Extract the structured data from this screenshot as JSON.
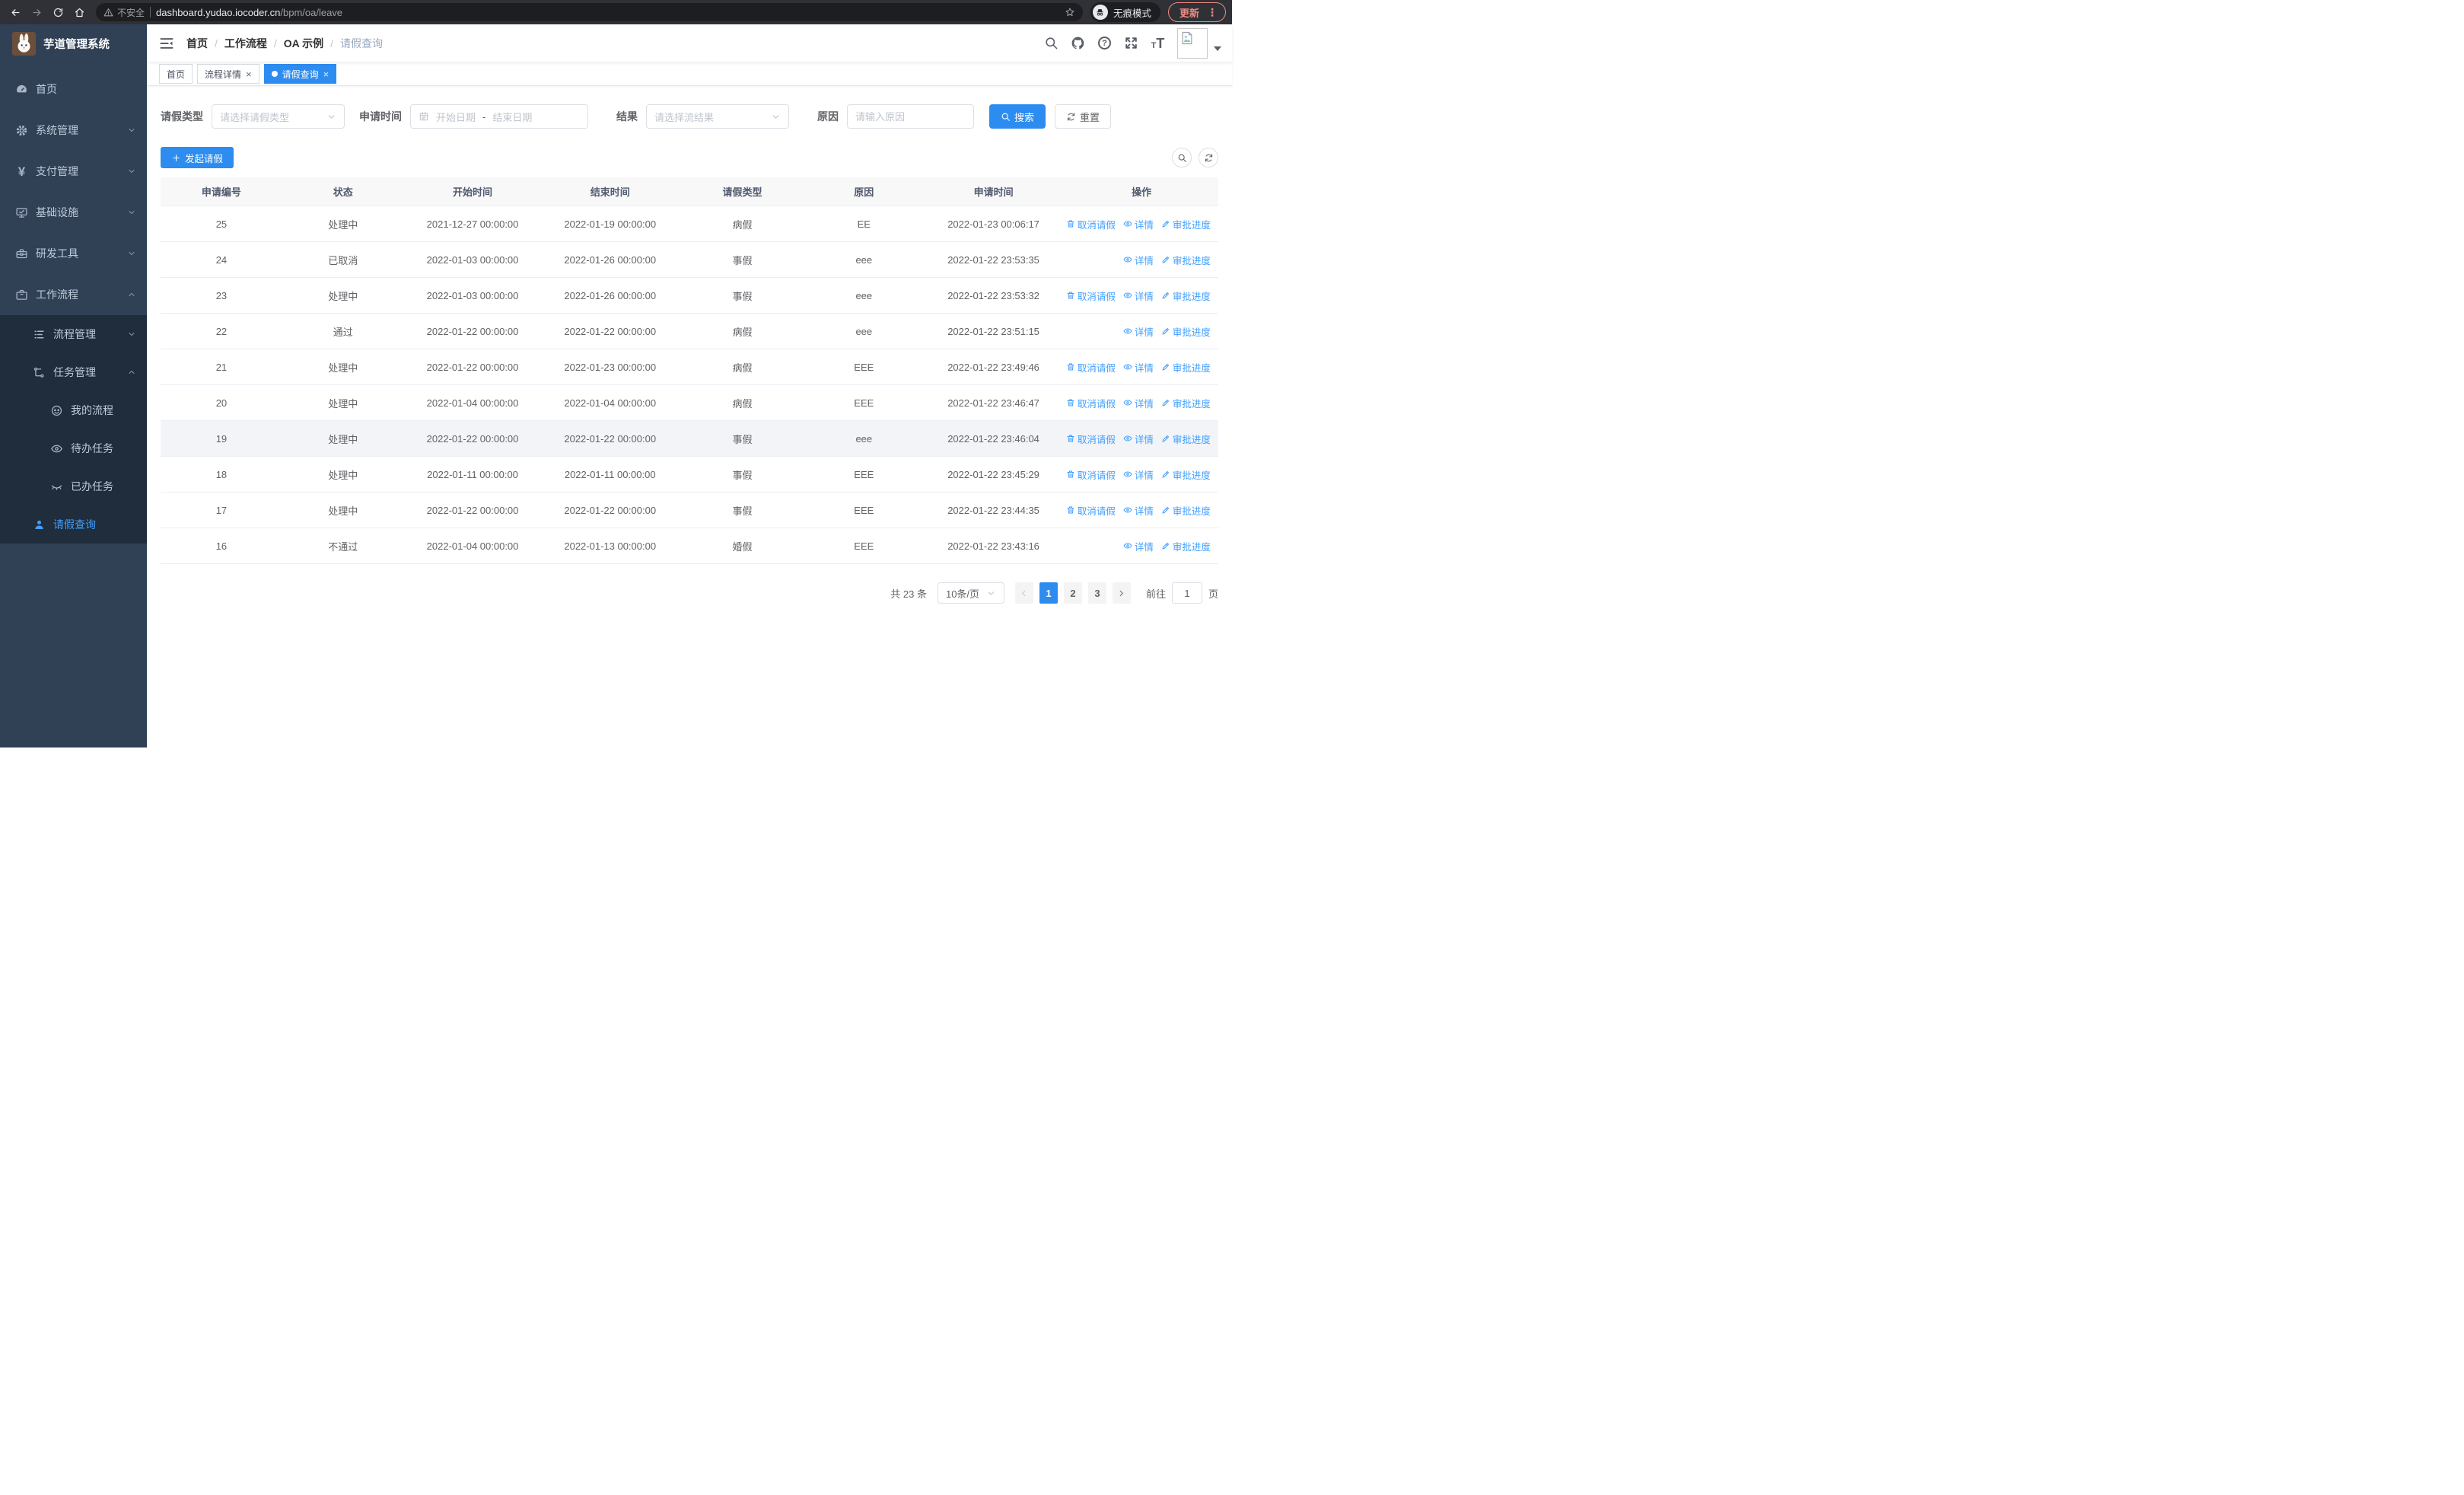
{
  "browser": {
    "security_warning": "不安全",
    "url_host": "dashboard.yudao.iocoder.cn",
    "url_path": "/bpm/oa/leave",
    "incognito_label": "无痕模式",
    "update_label": "更新"
  },
  "sidebar": {
    "app_title": "芋道管理系统",
    "items": [
      {
        "label": "首页",
        "icon": "dashboard-icon"
      },
      {
        "label": "系统管理",
        "icon": "gear-icon"
      },
      {
        "label": "支付管理",
        "icon": "yen-icon"
      },
      {
        "label": "基础设施",
        "icon": "monitor-icon"
      },
      {
        "label": "研发工具",
        "icon": "toolbox-icon"
      },
      {
        "label": "工作流程",
        "icon": "briefcase-icon"
      },
      {
        "label": "流程管理",
        "icon": "list-icon"
      },
      {
        "label": "任务管理",
        "icon": "tree-icon"
      },
      {
        "label": "我的流程",
        "icon": "face-icon"
      },
      {
        "label": "待办任务",
        "icon": "eye-icon"
      },
      {
        "label": "已办任务",
        "icon": "eye-closed-icon"
      },
      {
        "label": "请假查询",
        "icon": "user-icon"
      }
    ]
  },
  "header": {
    "breadcrumb": [
      "首页",
      "工作流程",
      "OA 示例",
      "请假查询"
    ],
    "separator": "/"
  },
  "tabs": [
    {
      "label": "首页",
      "closable": false,
      "active": false
    },
    {
      "label": "流程详情",
      "closable": true,
      "active": false
    },
    {
      "label": "请假查询",
      "closable": true,
      "active": true
    }
  ],
  "filters": {
    "type_label": "请假类型",
    "type_placeholder": "请选择请假类型",
    "time_label": "申请时间",
    "start_placeholder": "开始日期",
    "range_separator": "-",
    "end_placeholder": "结束日期",
    "result_label": "结果",
    "result_placeholder": "请选择流结果",
    "reason_label": "原因",
    "reason_placeholder": "请输入原因",
    "search_label": "搜索",
    "reset_label": "重置"
  },
  "toolbar": {
    "create_label": "发起请假"
  },
  "table": {
    "columns": [
      "申请编号",
      "状态",
      "开始时间",
      "结束时间",
      "请假类型",
      "原因",
      "申请时间",
      "操作"
    ],
    "actions": {
      "cancel": "取消请假",
      "detail": "详情",
      "progress": "审批进度"
    },
    "rows": [
      {
        "id": "25",
        "status": "处理中",
        "start": "2021-12-27 00:00:00",
        "end": "2022-01-19 00:00:00",
        "type": "病假",
        "reason": "EE",
        "applied": "2022-01-23 00:06:17"
      },
      {
        "id": "24",
        "status": "已取消",
        "start": "2022-01-03 00:00:00",
        "end": "2022-01-26 00:00:00",
        "type": "事假",
        "reason": "eee",
        "applied": "2022-01-22 23:53:35"
      },
      {
        "id": "23",
        "status": "处理中",
        "start": "2022-01-03 00:00:00",
        "end": "2022-01-26 00:00:00",
        "type": "事假",
        "reason": "eee",
        "applied": "2022-01-22 23:53:32"
      },
      {
        "id": "22",
        "status": "通过",
        "start": "2022-01-22 00:00:00",
        "end": "2022-01-22 00:00:00",
        "type": "病假",
        "reason": "eee",
        "applied": "2022-01-22 23:51:15"
      },
      {
        "id": "21",
        "status": "处理中",
        "start": "2022-01-22 00:00:00",
        "end": "2022-01-23 00:00:00",
        "type": "病假",
        "reason": "EEE",
        "applied": "2022-01-22 23:49:46"
      },
      {
        "id": "20",
        "status": "处理中",
        "start": "2022-01-04 00:00:00",
        "end": "2022-01-04 00:00:00",
        "type": "病假",
        "reason": "EEE",
        "applied": "2022-01-22 23:46:47"
      },
      {
        "id": "19",
        "status": "处理中",
        "start": "2022-01-22 00:00:00",
        "end": "2022-01-22 00:00:00",
        "type": "事假",
        "reason": "eee",
        "applied": "2022-01-22 23:46:04"
      },
      {
        "id": "18",
        "status": "处理中",
        "start": "2022-01-11 00:00:00",
        "end": "2022-01-11 00:00:00",
        "type": "事假",
        "reason": "EEE",
        "applied": "2022-01-22 23:45:29"
      },
      {
        "id": "17",
        "status": "处理中",
        "start": "2022-01-22 00:00:00",
        "end": "2022-01-22 00:00:00",
        "type": "事假",
        "reason": "EEE",
        "applied": "2022-01-22 23:44:35"
      },
      {
        "id": "16",
        "status": "不通过",
        "start": "2022-01-04 00:00:00",
        "end": "2022-01-13 00:00:00",
        "type": "婚假",
        "reason": "EEE",
        "applied": "2022-01-22 23:43:16"
      }
    ]
  },
  "pagination": {
    "total": "共 23 条",
    "page_size": "10条/页",
    "pages": [
      "1",
      "2",
      "3"
    ],
    "active_page": "1",
    "goto_label": "前往",
    "goto_value": "1",
    "page_unit": "页"
  },
  "icons": {
    "yen": "¥",
    "question": "?",
    "font_t": "T",
    "close": "×",
    "more_vert": "⋮",
    "names": [
      "back-icon",
      "forward-icon",
      "reload-icon",
      "home-icon",
      "warning-icon",
      "star-icon",
      "incognito-icon",
      "more-vert-icon",
      "collapse-icon",
      "search-icon",
      "github-icon",
      "help-icon",
      "fullscreen-icon",
      "font-size-icon",
      "avatar-caret-icon",
      "calendar-icon",
      "chevron-down-icon",
      "chevron-up-icon",
      "plus-icon",
      "refresh-icon",
      "delete-icon",
      "view-icon",
      "edit-icon",
      "close-icon",
      "dot-icon",
      "chevron-left-icon",
      "chevron-right-icon"
    ]
  },
  "colors": {
    "accent": "#2d8cf0",
    "link": "#409eff",
    "sidebar_bg": "#304156",
    "submenu_bg": "#1f2d3d",
    "active_text": "#409eff",
    "update_button": "#ef8a80",
    "table_header_bg": "#f8f8f9"
  }
}
